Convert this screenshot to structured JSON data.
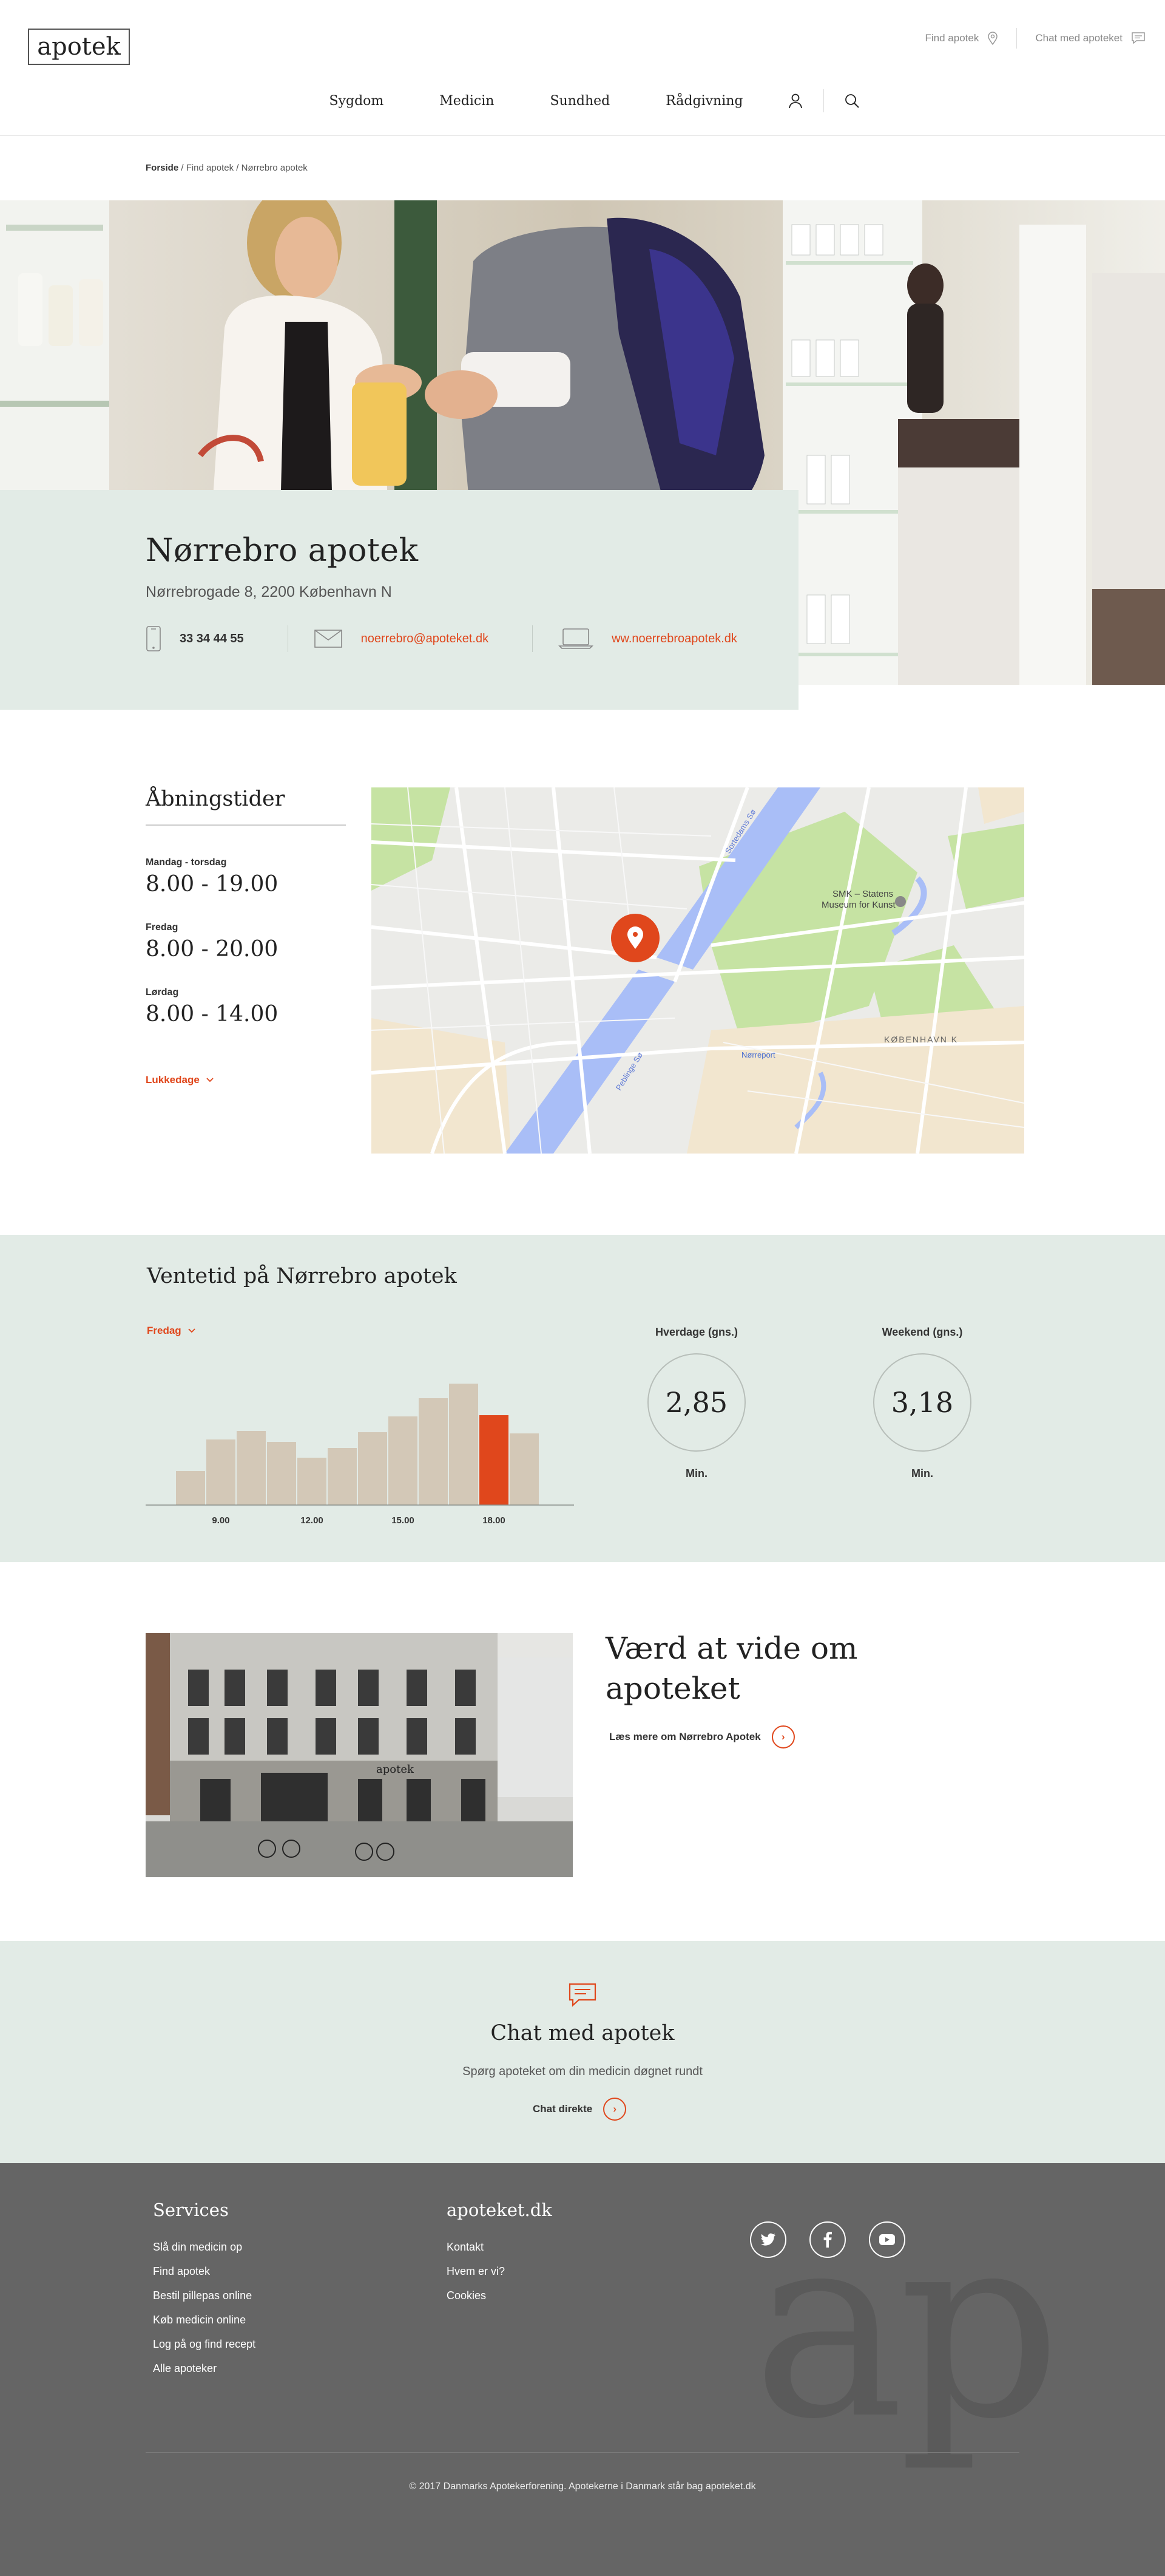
{
  "header": {
    "logo": "apotek",
    "top_links": [
      {
        "label": "Find apotek",
        "icon": "location-pin-icon"
      },
      {
        "label": "Chat med apoteket",
        "icon": "chat-bubble-icon"
      }
    ],
    "nav": [
      "Sygdom",
      "Medicin",
      "Sundhed",
      "Rådgivning"
    ]
  },
  "breadcrumb": {
    "home": "Forside",
    "rest": " / Find apotek / Nørrebro apotek"
  },
  "pharmacy": {
    "name": "Nørrebro apotek",
    "address": "Nørrebrogade 8, 2200 København N",
    "phone": "33 34 44 55",
    "email": "noerrebro@apoteket.dk",
    "website": "ww.noerrebroapotek.dk"
  },
  "opening": {
    "title": "Åbningstider",
    "days": [
      {
        "label": "Mandag - torsdag",
        "hours": "8.00 - 19.00"
      },
      {
        "label": "Fredag",
        "hours": "8.00 - 20.00"
      },
      {
        "label": "Lørdag",
        "hours": "8.00 - 14.00"
      }
    ],
    "closed_link": "Lukkedage"
  },
  "map": {
    "labels": {
      "museum": "SMK – Statens",
      "museum2": "Museum for Kunst",
      "district": "KØBENHAVN K",
      "lake": "Peblinge Sø",
      "lake2": "Sortedams Sø",
      "station": "Nørreport"
    }
  },
  "wait": {
    "title": "Ventetid på Nørrebro apotek",
    "selected_day": "Fredag",
    "stats": [
      {
        "label": "Hverdage (gns.)",
        "value": "2,85",
        "unit": "Min."
      },
      {
        "label": "Weekend  (gns.)",
        "value": "3,18",
        "unit": "Min."
      }
    ]
  },
  "chart_data": {
    "type": "bar",
    "categories": [
      "8",
      "9",
      "10",
      "11",
      "12",
      "13",
      "14",
      "15",
      "16",
      "17",
      "18",
      "19"
    ],
    "tick_labels": [
      "9.00",
      "12.00",
      "15.00",
      "18.00"
    ],
    "values": [
      2.8,
      5.4,
      6.1,
      5.2,
      3.9,
      4.7,
      6.0,
      7.3,
      8.8,
      10.0,
      7.4,
      5.9
    ],
    "highlight_index": 10,
    "colors": {
      "bar": "#d3c8b7",
      "highlight": "#e0471c"
    }
  },
  "about": {
    "title": "Værd at vide om apoteket",
    "link": "Læs mere om Nørrebro Apotek",
    "sign": "apotek"
  },
  "chat": {
    "title": "Chat med apotek",
    "subtitle": "Spørg apoteket om din medicin døgnet rundt",
    "cta": "Chat direkte"
  },
  "footer": {
    "services_title": "Services",
    "services": [
      "Slå din medicin op",
      "Find apotek",
      "Bestil pillepas online",
      "Køb medicin online",
      "Log på og find recept",
      "Alle apoteker"
    ],
    "site_title": "apoteket.dk",
    "site_links": [
      "Kontakt",
      "Hvem er vi?",
      "Cookies"
    ],
    "social": [
      "twitter-icon",
      "facebook-icon",
      "youtube-icon"
    ],
    "watermark": "ap",
    "copyright": "© 2017 Danmarks Apotekerforening. Apotekerne i Danmark står bag apoteket.dk"
  },
  "colors": {
    "accent": "#e0471c",
    "panel": "#e2ebe6",
    "footer": "#656565"
  }
}
